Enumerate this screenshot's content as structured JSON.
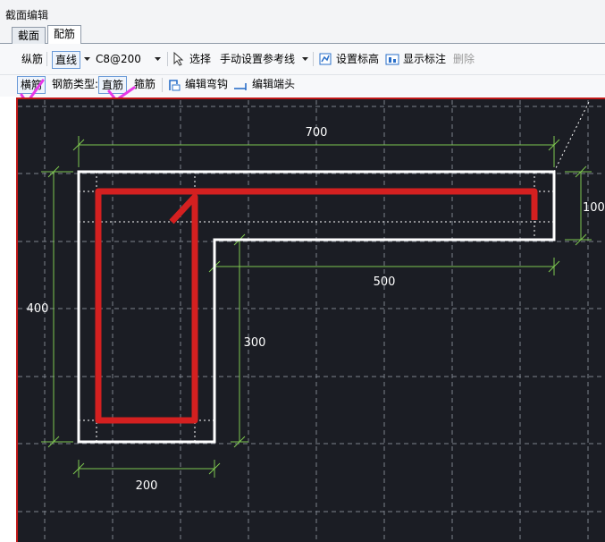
{
  "window": {
    "title": "截面编辑"
  },
  "tabs": [
    {
      "label": "截面"
    },
    {
      "label": "配筋"
    }
  ],
  "toolbar1": {
    "longitudinal_label": "纵筋",
    "line_mode_value": "直线",
    "spec_value": "C8@200",
    "select_label": "选择",
    "manual_ref_label": "手动设置参考线",
    "set_elevation_label": "设置标高",
    "show_annotation_label": "显示标注",
    "delete_label": "删除"
  },
  "toolbar2": {
    "transverse_label": "横筋",
    "rebar_type_label": "钢筋类型:",
    "straight_rebar_label": "直筋",
    "stirrup_label": "箍筋",
    "edit_hook_label": "编辑弯钩",
    "edit_end_label": "编辑端头"
  },
  "drawing": {
    "dimensions": {
      "top_width": "700",
      "right_height": "100",
      "flange_width": "500",
      "left_height": "400",
      "web_height": "300",
      "bottom_width": "200"
    },
    "colors": {
      "background": "#1b1d24",
      "outline": "#ffffff",
      "dimension": "#7ec850",
      "rebar": "#d42020",
      "grid": "#8a8f99"
    }
  }
}
